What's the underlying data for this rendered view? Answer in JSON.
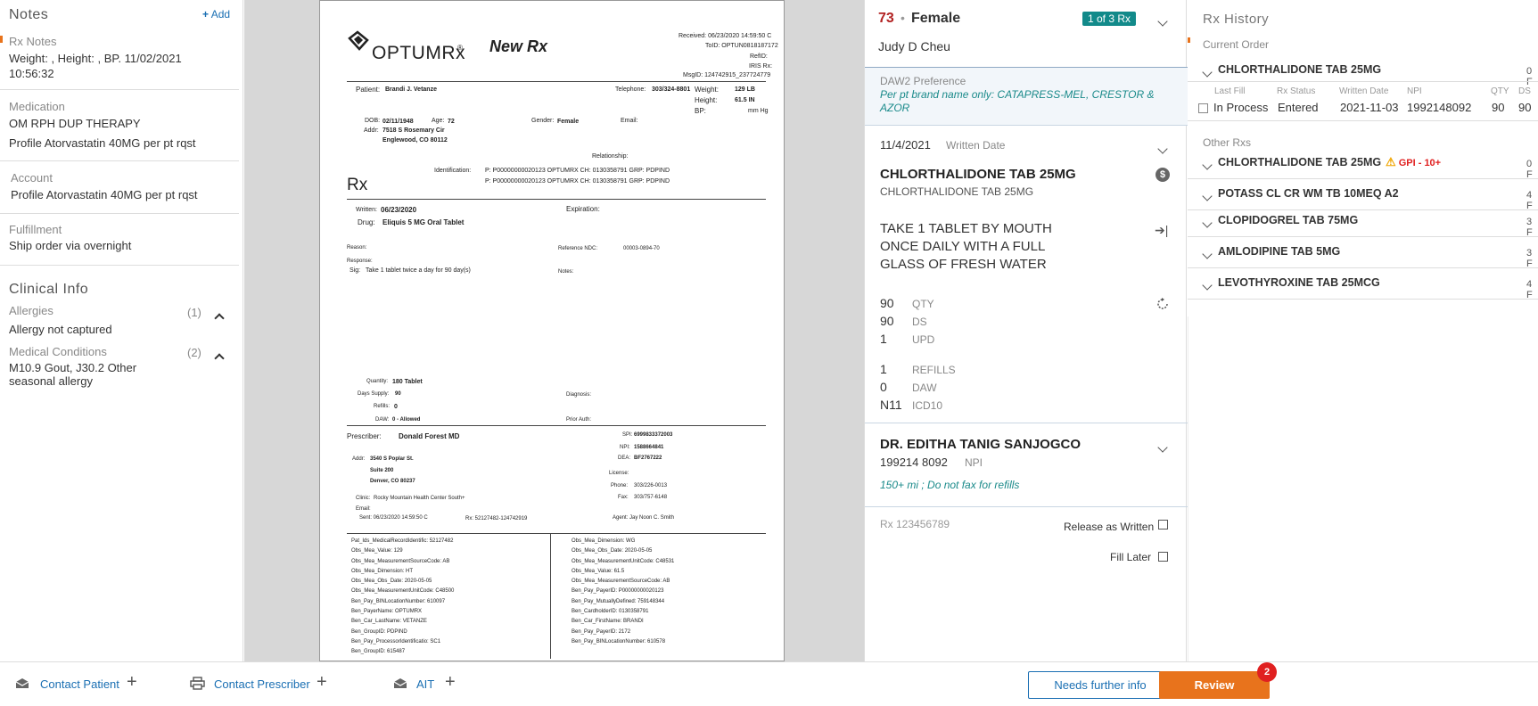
{
  "notes": {
    "title": "Notes",
    "add_label": "Add",
    "rx_notes_label": "Rx Notes",
    "rx_notes_text": "Weight: , Height: , BP. 11/02/2021 10:56:32",
    "medication_label": "Medication",
    "medication_line1": "OM RPH DUP THERAPY",
    "medication_line2": "Profile Atorvastatin 40MG per pt rqst",
    "account_label": "Account",
    "account_text": "Profile Atorvastatin 40MG per pt rqst",
    "fulfillment_label": "Fulfillment",
    "fulfillment_text": "Ship order via overnight",
    "clinical_title": "Clinical Info",
    "allergies_label": "Allergies",
    "allergies_count": "(1)",
    "allergies_text": "Allergy not captured",
    "conditions_label": "Medical Conditions",
    "conditions_count": "(2)",
    "conditions_text": "M10.9 Gout, J30.2 Other seasonal allergy"
  },
  "doc": {
    "logo": "OPTUMRx",
    "logo_mark": "®",
    "title": "New Rx",
    "received": "Received: 06/23/2020 14:59:50 C",
    "toid": "ToID: OPTUN0818187172",
    "refid": "RefID:",
    "irisrx": "IRIS Rx:",
    "msgid": "MsgID: 124742915_237724779",
    "patient_label": "Patient:",
    "patient": "Brandi J. Vetanze",
    "telephone_label": "Telephone:",
    "telephone": "303/324-8801",
    "weight_label": "Weight:",
    "weight": "129 LB",
    "height_label": "Height:",
    "height": "61.5 IN",
    "bp_label": "BP:",
    "bp_unit": "mm Hg",
    "dob_label": "DOB:",
    "dob": "02/11/1948",
    "age_label": "Age:",
    "age": "72",
    "gender_label": "Gender:",
    "gender": "Female",
    "email_label": "Email:",
    "addr_label": "Addr:",
    "addr1": "7518 S Rosemary Cir",
    "addr2": "Englewood, CO 80112",
    "relationship_label": "Relationship:",
    "identification_label": "Identification:",
    "ident1": "P: P00000000020123 OPTUMRX CH: 0130358791 GRP: PDPIND",
    "ident2": "P: P00000000020123 OPTUMRX CH: 0130358791 GRP: PDPIND",
    "rx_heading": "Rx",
    "written_label": "Written:",
    "written": "06/23/2020",
    "expiration_label": "Expiration:",
    "drug_label": "Drug:",
    "drug": "Eliquis 5 MG Oral Tablet",
    "reason_label": "Reason:",
    "refndc_label": "Reference NDC:",
    "refndc": "00003-0894-70",
    "response_label": "Response:",
    "sig_label": "Sig:",
    "sig": "Take 1 tablet twice a day for 90 day(s)",
    "notes_label": "Notes:",
    "quantity_label": "Quantity:",
    "quantity": "180 Tablet",
    "days_label": "Days Supply:",
    "days": "90",
    "diagnosis_label": "Diagnosis:",
    "refills_label": "Refills:",
    "refills": "0",
    "daw_label": "DAW:",
    "daw": "0 - Allowed",
    "prior_label": "Prior Auth:",
    "prescriber_label": "Prescriber:",
    "prescriber": "Donald Forest MD",
    "spi_label": "SPI:",
    "spi": "6999833372003",
    "npi_label": "NPI:",
    "npi": "1588664841",
    "dea_label": "DEA:",
    "dea": "BF2767222",
    "paddr_label": "Addr:",
    "paddr1": "3540 S Poplar St.",
    "paddr2": "Suite 200",
    "paddr3": "Denver, CO 80237",
    "license_label": "License:",
    "phone_label": "Phone:",
    "phone": "303/226-0013",
    "clinic_label": "Clinic:",
    "clinic": "Rocky Mountain Health Center South+",
    "fax_label": "Fax:",
    "fax": "303/757-6148",
    "email2_label": "Email:",
    "sent": "Sent: 06/23/2020 14:59:50 C",
    "rx_id": "Rx: 52127482-124742919",
    "agent": "Agent: Jay Noon C. Smith",
    "obs_left": [
      "Pat_Ids_MedicalRecordIdentific: 52127482",
      "Obs_Mea_Value: 129",
      "Obs_Mea_MeasurementSourceCode: AB",
      "Obs_Mea_Dimension: HT",
      "Obs_Mea_Obs_Date: 2020-05-05",
      "Obs_Mea_MeasurementUnitCode: C48500",
      "Ben_Pay_BINLocationNumber: 610097",
      "Ben_PayerName: OPTUMRX",
      "Ben_Car_LastName: VETANZE",
      "Ben_GroupID: PDPIND",
      "Ben_Pay_ProcessorIdentificatio: SC1",
      "Ben_GroupID: 615487"
    ],
    "obs_right": [
      "Obs_Mea_Dimension: WG",
      "Obs_Mea_Obs_Date: 2020-05-05",
      "Obs_Mea_MeasurementUnitCode: C48531",
      "Obs_Mea_Value: 61.5",
      "Obs_Mea_MeasurementSourceCode: AB",
      "Ben_Pay_PayerID: P00000000020123",
      "Ben_Pay_MutuallyDefined: 759148344",
      "Ben_CardholderID: 0130358791",
      "Ben_Car_FirstName: BRANDI",
      "Ben_Pay_PayerID: 2172",
      "Ben_Pay_BINLocationNumber: 610578"
    ]
  },
  "rx": {
    "age": "73",
    "sep": "•",
    "gender": "Female",
    "badge": "1 of 3 Rx",
    "patient_name": "Judy D Cheu",
    "daw2_label": "DAW2 Preference",
    "daw2_text": "Per pt brand name only: CATAPRESS-MEL, CRESTOR & AZOR",
    "written_date": "11/4/2021",
    "written_label": "Written Date",
    "drug_name": "CHLORTHALIDONE TAB 25MG",
    "drug_sub": "CHLORTHALIDONE TAB 25MG",
    "sig": "TAKE 1 TABLET BY MOUTH ONCE DAILY WITH A FULL GLASS OF FRESH WATER",
    "qty": "90",
    "qty_label": "QTY",
    "ds": "90",
    "ds_label": "DS",
    "upd": "1",
    "upd_label": "UPD",
    "refills": "1",
    "refills_label": "REFILLS",
    "daw": "0",
    "daw_label": "DAW",
    "icd": "N11",
    "icd_label": "ICD10",
    "prescriber": "DR. EDITHA TANIG SANJOGCO",
    "npi": "199214 8092",
    "npi_label": "NPI",
    "prescriber_note": "150+ mi ;  Do not fax for refills",
    "rx_number": "Rx 123456789",
    "release_label": "Release as Written",
    "fill_later_label": "Fill Later"
  },
  "history": {
    "title": "Rx History",
    "current_label": "Current Order",
    "current_drug": "CHLORTHALIDONE TAB 25MG",
    "current_right": "0 F",
    "cols": [
      "Last Fill",
      "Rx Status",
      "Written Date",
      "NPI",
      "QTY",
      "DS"
    ],
    "row": {
      "last_fill": "In Process",
      "status": "Entered",
      "written": "2021-11-03",
      "npi": "1992148092",
      "qty": "90",
      "ds": "90"
    },
    "other_label": "Other Rxs",
    "others": [
      {
        "name": "CHLORTHALIDONE TAB 25MG",
        "right": "0 F",
        "warn": "GPI - 10+"
      },
      {
        "name": "POTASS CL CR WM TB 10MEQ A2",
        "right": "4 F",
        "warn": ""
      },
      {
        "name": "CLOPIDOGREL TAB 75MG",
        "right": "3 F",
        "warn": ""
      },
      {
        "name": "AMLODIPINE TAB 5MG",
        "right": "3 F",
        "warn": ""
      },
      {
        "name": "LEVOTHYROXINE TAB 25MCG",
        "right": "4 F",
        "warn": ""
      }
    ]
  },
  "bottom": {
    "contact_patient": "Contact Patient",
    "contact_prescriber": "Contact Prescriber",
    "ait": "AIT",
    "needs_info": "Needs further info",
    "review": "Review",
    "review_badge": "2"
  },
  "colors": {
    "accent": "#1a6fb3",
    "orange": "#e8731c",
    "teal": "#1a8a8a",
    "badge_teal": "#128a8a",
    "red": "#b22222",
    "badge_red": "#e02020",
    "warn": "#f0a500"
  }
}
